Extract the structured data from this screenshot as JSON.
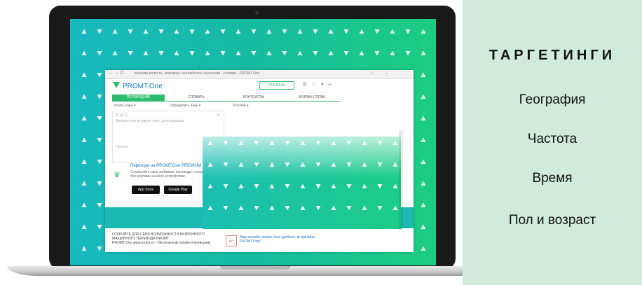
{
  "targeting": {
    "title": "ТАРГЕТИНГИ",
    "items": [
      "География",
      "Частота",
      "Время",
      "Пол и возраст"
    ]
  },
  "browser": {
    "nav": "← → C",
    "url": "translate.promt.ru · перевод с английского на русский · словарь · PROMT.One",
    "icons": "☆ ⋮"
  },
  "promt": {
    "logo": "PROMT.One",
    "premium_label": "PREMIUM",
    "header_icons": "⚙ ☆ ▾ ≡",
    "tabs": [
      "ПЕРЕВОДЧИК",
      "СЛОВАРЬ",
      "КОНТЕКСТЫ",
      "ФОРМЫ СЛОВА"
    ],
    "lang_source": "Узнать язык ▾",
    "lang_mid": "Определить язык ▾",
    "lang_target": "Русский ▾",
    "source_icons": "⎘ ⊕ ⇆",
    "placeholder": "Введите или вставьте текст для перевода",
    "example_label": "Пример",
    "promo_title": "Переходи на PROMT.One PREMIUM",
    "promo_desc": "Сохраняйте свои любимые переводы, пользуйтесь без рекламы на всех устройствах",
    "app_store": "App Store",
    "google_play": "Google Play",
    "ad_text": "ОТКРОЙТЕ ДЛЯ СЕБЯ ВОЗМОЖНОСТИ НЕЙРОННОГО МАШИННОГО ПЕРЕВОДА PROMT",
    "ad_sub": "PROMT.One www.promt.ru – бесплатный онлайн-переводчик",
    "ad_right_icon": "16+",
    "ad_right_text": "Наш онлайн-сервис стал удобнее: встречайте PROMT.One!"
  },
  "colors": {
    "panel_bg": "#d0eadc",
    "screen_teal": "#18b9c0",
    "screen_green": "#1ccd80",
    "promt_green": "#2dbb6f",
    "link_blue": "#1a73c7"
  }
}
